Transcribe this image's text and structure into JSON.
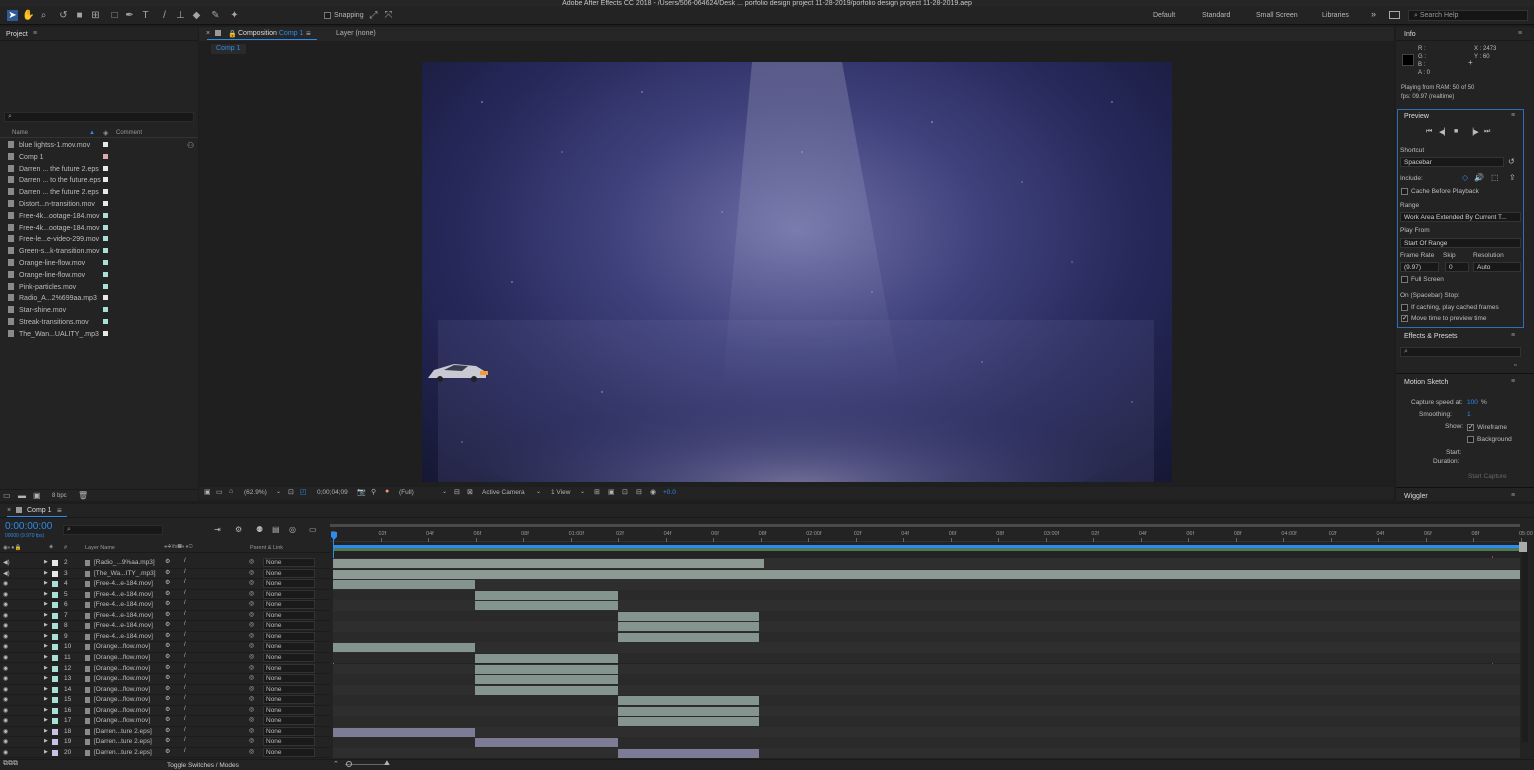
{
  "app": {
    "title": "Adobe After Effects CC 2018 - /Users/506-064624/Desk ... porfolio design project 11-28-2019/porfolio design project 11-28-2019.aep"
  },
  "toolbar": {
    "snapping_label": "Snapping",
    "workspaces": [
      "Default",
      "Standard",
      "Small Screen",
      "Libraries"
    ],
    "search_placeholder": "Search Help"
  },
  "project": {
    "panel_title": "Project",
    "col_name": "Name",
    "col_comment": "Comment",
    "bpc": "8 bpc",
    "items": [
      {
        "name": "blue lightss-1.mov.mov",
        "color": "#e8e8e8"
      },
      {
        "name": "Comp 1",
        "color": "#d9a9b0"
      },
      {
        "name": "Darren ... the future 2.eps",
        "color": "#e8e8e8"
      },
      {
        "name": "Darren ... to the future.eps",
        "color": "#e8e8e8"
      },
      {
        "name": "Darren ... the future 2.eps",
        "color": "#e8e8e8"
      },
      {
        "name": "Distort...n-transition.mov",
        "color": "#e8e8e8"
      },
      {
        "name": "Free-4k...ootage-184.mov",
        "color": "#a8e0d8"
      },
      {
        "name": "Free-4k...ootage-184.mov",
        "color": "#a8e0d8"
      },
      {
        "name": "Free-le...e-video-299.mov",
        "color": "#a8e0d8"
      },
      {
        "name": "Green-s...k-transition.mov",
        "color": "#a8e0d8"
      },
      {
        "name": "Orange-line-flow.mov",
        "color": "#a8e0d8"
      },
      {
        "name": "Orange-line-flow.mov",
        "color": "#a8e0d8"
      },
      {
        "name": "Pink-particles.mov",
        "color": "#a8e0d8"
      },
      {
        "name": "Radio_A...2%699aa.mp3",
        "color": "#e8e8e8"
      },
      {
        "name": "Star-shine.mov",
        "color": "#a8e0d8"
      },
      {
        "name": "Streak-transitions.mov",
        "color": "#a8e0d8"
      },
      {
        "name": "The_Wan...UALITY_.mp3",
        "color": "#e8e8e8"
      }
    ]
  },
  "composition": {
    "tab_prefix": "Composition",
    "tab_name": "Comp 1",
    "layer_tab": "Layer (none)",
    "breadcrumb": "Comp 1",
    "zoom": "(62.9%)",
    "timecode": "0;00;04;09",
    "resolution": "(Full)",
    "camera": "Active Camera",
    "views": "1 View",
    "exposure": "+0.0"
  },
  "info": {
    "panel_title": "Info",
    "r": "R :",
    "g": "G :",
    "b": "B :",
    "a": "A : 0",
    "x": "X : 2473",
    "y": "Y : 60",
    "status1": "Playing from RAM: 50 of 50",
    "status2": "fps: 09.97 (realtime)"
  },
  "preview": {
    "panel_title": "Preview",
    "shortcut_label": "Shortcut",
    "shortcut_value": "Spacebar",
    "include_label": "Include:",
    "cache_label": "Cache Before Playback",
    "range_label": "Range",
    "range_value": "Work Area Extended By Current T...",
    "playfrom_label": "Play From",
    "playfrom_value": "Start Of Range",
    "framerate_label": "Frame Rate",
    "skip_label": "Skip",
    "resolution_label": "Resolution",
    "framerate_value": "(9.97)",
    "skip_value": "0",
    "resolution_value": "Auto",
    "fullscreen_label": "Full Screen",
    "stop_label": "On (Spacebar) Stop:",
    "stop_opt1": "If caching, play cached frames",
    "stop_opt2": "Move time to preview time"
  },
  "effects": {
    "panel_title": "Effects & Presets"
  },
  "motion_sketch": {
    "panel_title": "Motion Sketch",
    "capture_label": "Capture speed at:",
    "capture_value": "100",
    "capture_unit": "%",
    "smoothing_label": "Smoothing:",
    "smoothing_value": "1",
    "show_label": "Show:",
    "wireframe_label": "Wireframe",
    "background_label": "Background",
    "start_label": "Start:",
    "duration_label": "Duration:",
    "start_capture": "Start Capture"
  },
  "wiggler": {
    "panel_title": "Wiggler"
  },
  "timeline": {
    "tab_name": "Comp 1",
    "current_time": "0:00:00:00",
    "frame_info": "00000 (9.970 fps)",
    "col_layer_name": "Layer Name",
    "col_parent": "Parent & Link",
    "col_num": "#",
    "toggle_label": "Toggle Switches / Modes",
    "ruler": [
      "0f",
      "02f",
      "04f",
      "06f",
      "08f",
      "01:00f",
      "02f",
      "04f",
      "06f",
      "08f",
      "02:00f",
      "02f",
      "04f",
      "06f",
      "08f",
      "03:00f",
      "02f",
      "04f",
      "06f",
      "08f",
      "04:00f",
      "02f",
      "04f",
      "06f",
      "08f",
      "05:00"
    ],
    "parent_value": "None",
    "layers": [
      {
        "num": "2",
        "name": "[Radio_...9%aa.mp3]",
        "audio": true,
        "start": 0,
        "end": 0.363,
        "color": "#8d9a93"
      },
      {
        "num": "3",
        "name": "[The_Wa...ITY_.mp3]",
        "audio": true,
        "start": 0,
        "end": 1,
        "color": "#8d9a93"
      },
      {
        "num": "4",
        "name": "[Free-4...e-184.mov]",
        "audio": false,
        "start": 0,
        "end": 0.12,
        "color": "#849590"
      },
      {
        "num": "5",
        "name": "[Free-4...e-184.mov]",
        "audio": false,
        "start": 0.12,
        "end": 0.24,
        "color": "#849590"
      },
      {
        "num": "6",
        "name": "[Free-4...e-184.mov]",
        "audio": false,
        "start": 0.12,
        "end": 0.24,
        "color": "#849590"
      },
      {
        "num": "7",
        "name": "[Free-4...e-184.mov]",
        "audio": false,
        "start": 0.24,
        "end": 0.359,
        "color": "#849590"
      },
      {
        "num": "8",
        "name": "[Free-4...e-184.mov]",
        "audio": false,
        "start": 0.24,
        "end": 0.359,
        "color": "#849590"
      },
      {
        "num": "9",
        "name": "[Free-4...e-184.mov]",
        "audio": false,
        "start": 0.24,
        "end": 0.359,
        "color": "#849590"
      },
      {
        "num": "10",
        "name": "[Orange...flow.mov]",
        "audio": false,
        "start": 0,
        "end": 0.12,
        "color": "#849590"
      },
      {
        "num": "11",
        "name": "[Orange...flow.mov]",
        "audio": false,
        "start": 0.12,
        "end": 0.24,
        "color": "#849590"
      },
      {
        "num": "12",
        "name": "[Orange...flow.mov]",
        "audio": false,
        "start": 0.12,
        "end": 0.24,
        "color": "#849590"
      },
      {
        "num": "13",
        "name": "[Orange...flow.mov]",
        "audio": false,
        "start": 0.12,
        "end": 0.24,
        "color": "#849590"
      },
      {
        "num": "14",
        "name": "[Orange...flow.mov]",
        "audio": false,
        "start": 0.12,
        "end": 0.24,
        "color": "#849590"
      },
      {
        "num": "15",
        "name": "[Orange...flow.mov]",
        "audio": false,
        "start": 0.24,
        "end": 0.359,
        "color": "#849590"
      },
      {
        "num": "16",
        "name": "[Orange...flow.mov]",
        "audio": false,
        "start": 0.24,
        "end": 0.359,
        "color": "#849590"
      },
      {
        "num": "17",
        "name": "[Orange...flow.mov]",
        "audio": false,
        "start": 0.24,
        "end": 0.359,
        "color": "#849590"
      },
      {
        "num": "18",
        "name": "[Darren...ture 2.eps]",
        "audio": false,
        "start": 0,
        "end": 0.12,
        "color": "#7d7c96"
      },
      {
        "num": "19",
        "name": "[Darren...ture 2.eps]",
        "audio": false,
        "start": 0.12,
        "end": 0.24,
        "color": "#7d7c96"
      },
      {
        "num": "20",
        "name": "[Darren...ture 2.eps]",
        "audio": false,
        "start": 0.24,
        "end": 0.359,
        "color": "#7d7c96"
      }
    ]
  },
  "colors": {
    "accent": "#2d8ceb",
    "playhead": "#c0392b",
    "work_area": "#4f7a5a"
  }
}
